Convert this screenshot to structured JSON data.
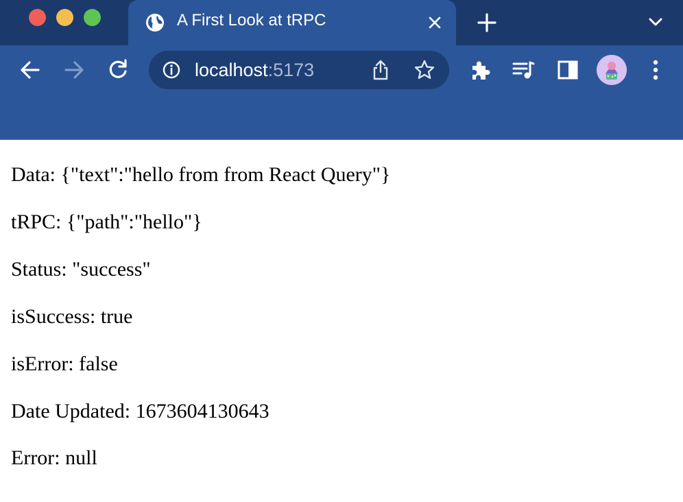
{
  "browser": {
    "tab": {
      "title": "A First Look at tRPC",
      "favicon": "globe-icon",
      "close": "×"
    },
    "omnibox": {
      "host": "localhost",
      "port": ":5173"
    },
    "colors": {
      "tab_strip": "#1b3a6b",
      "toolbar": "#2b5699",
      "omnibox": "#1d3e72",
      "close_light": "#ee5f57",
      "minimize_light": "#f4bd4f",
      "zoom_light": "#5fc454"
    }
  },
  "content": {
    "lines": [
      "Data: {\"text\":\"hello from from React Query\"}",
      "tRPC: {\"path\":\"hello\"}",
      "Status: \"success\"",
      "isSuccess: true",
      "isError: false",
      "Date Updated: 1673604130643",
      "Error: null"
    ]
  }
}
